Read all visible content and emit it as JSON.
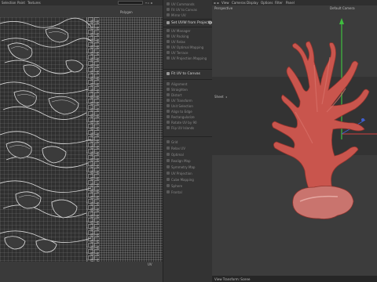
{
  "uv_editor": {
    "menu": [
      "Selection",
      "Paint",
      "Textures"
    ],
    "mode": "Polygon",
    "corner_label": "UV"
  },
  "palette": {
    "group1": [
      "UV Commands",
      "Fit UV to Canvas",
      "Mirror UV",
      "Stack UV Islands"
    ],
    "active1": "Set UVW from Projection",
    "group2": [
      "UV Manager",
      "UV Packing",
      "UV Relax",
      "UV Optimal Mapping",
      "UV Terrace",
      "UV Projection Mapping"
    ],
    "active2": "Fit UV to Canvas",
    "group3": [
      "Alignment",
      "Straighten",
      "Distort",
      "UV Transform",
      "Unit Selection",
      "Align to Edge",
      "Rectangularize",
      "Rotate UV by 90",
      "Flip UV Islands"
    ],
    "group4": [
      "Grid",
      "Relax UV",
      "Optimal",
      "Realign Map",
      "Symmetry Map",
      "UV Projection",
      "Cube Mapping",
      "Sphere",
      "Frontal"
    ]
  },
  "viewport": {
    "menu": [
      "View",
      "Cameras",
      "Display",
      "Options",
      "Filter",
      "Panel"
    ],
    "view_name": "Perspective",
    "camera_name": "Default Camera",
    "sheet_label": "Sheet",
    "footer_text": "View Transform: Scene",
    "model_color": "#c9554d",
    "model_shadow": "#9e3c35",
    "model_highlight": "#d9726a"
  }
}
